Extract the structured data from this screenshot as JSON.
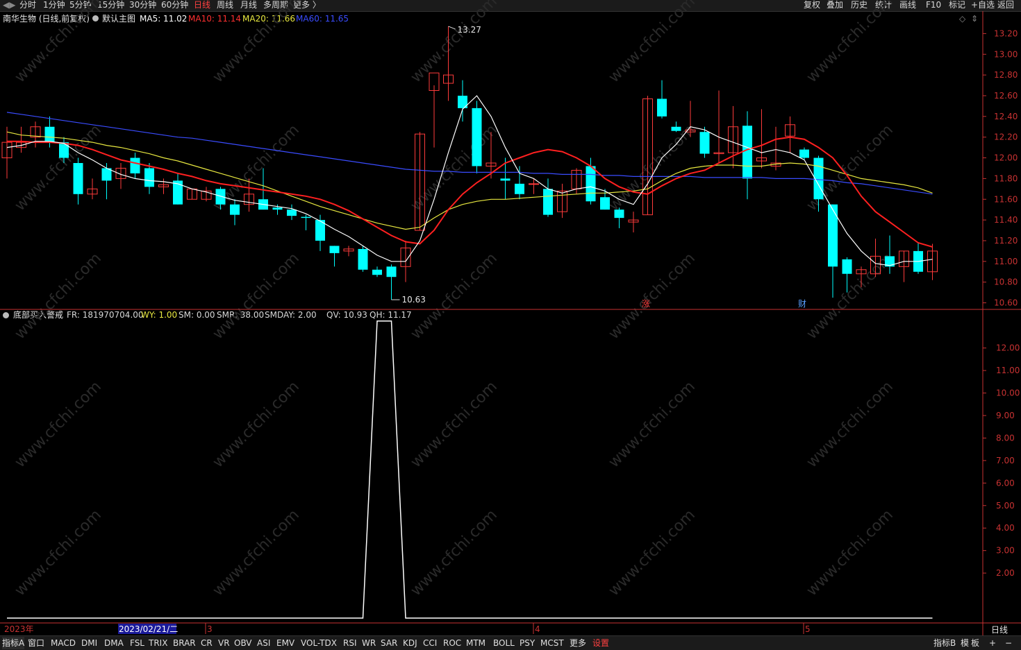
{
  "topbar": {
    "left": [
      "分时",
      "1分钟",
      "5分钟",
      "15分钟",
      "30分钟",
      "60分钟",
      "日线",
      "周线",
      "月线",
      "多周期",
      "更多 〉"
    ],
    "right": [
      "复权",
      "叠加",
      "历史",
      "统计",
      "画线",
      "F10",
      "标记",
      "+自选",
      "返回"
    ]
  },
  "main": {
    "stock_title": "南华生物 (日线,前复权)",
    "template": "默认主图",
    "ma_labels": [
      {
        "text": "MA5: 11.02",
        "color": "#ffffff"
      },
      {
        "text": "MA10: 11.14",
        "color": "#ff3030"
      },
      {
        "text": "MA20: 11.66",
        "color": "#e8e840"
      },
      {
        "text": "MA60: 11.65",
        "color": "#3a4cff"
      }
    ],
    "high_label": "13.27",
    "low_label": "10.63",
    "marker_zhang": "涨",
    "marker_cai": "财",
    "y_ticks": [
      "13.20",
      "13.00",
      "12.80",
      "12.60",
      "12.40",
      "12.20",
      "12.00",
      "11.80",
      "11.60",
      "11.40",
      "11.20",
      "11.00",
      "10.80",
      "10.60"
    ]
  },
  "indicator": {
    "name": "底部买入警戒",
    "fields": [
      {
        "text": "FR: 181970704.00",
        "color": "#d8d8d8"
      },
      {
        "text": "WY: 1.00",
        "color": "#e8e840"
      },
      {
        "text": "SM: 0.00",
        "color": "#d8d8d8"
      },
      {
        "text": "SMR: 38.00",
        "color": "#d8d8d8"
      },
      {
        "text": "SMDAY: 2.00",
        "color": "#d8d8d8"
      },
      {
        "text": "QV: 10.93",
        "color": "#d8d8d8"
      },
      {
        "text": "QH: 11.17",
        "color": "#d8d8d8"
      }
    ],
    "y_ticks": [
      "12.00",
      "11.00",
      "10.00",
      "9.00",
      "8.00",
      "7.00",
      "6.00",
      "5.00",
      "4.00",
      "3.00",
      "2.00"
    ]
  },
  "time_axis": {
    "year": "2023年",
    "date_box": "2023/02/21/二",
    "months": [
      "3",
      "4",
      "5"
    ],
    "period_label": "日线"
  },
  "bottombar": {
    "items": [
      "指标A",
      "窗口",
      "MACD",
      "DMI",
      "DMA",
      "FSL",
      "TRIX",
      "BRAR",
      "CR",
      "VR",
      "OBV",
      "ASI",
      "EMV",
      "VOL-TDX",
      "RSI",
      "WR",
      "SAR",
      "KDJ",
      "CCI",
      "ROC",
      "MTM",
      "BOLL",
      "PSY",
      "MCST",
      "更多",
      "设置"
    ],
    "right": [
      "指标B",
      "模",
      "板",
      "+",
      "−"
    ]
  },
  "watermark": "www.cfchi.com",
  "colors": {
    "up": "#ff3b3b",
    "down": "#00ffff",
    "ma5": "#ffffff",
    "ma10": "#ff2020",
    "ma20": "#e8e840",
    "ma60": "#3a4cff",
    "axis": "#c83232"
  },
  "chart_data": {
    "type": "candlestick",
    "title": "南华生物 (日线,前复权)",
    "ylim": [
      10.55,
      13.35
    ],
    "candles": [
      {
        "o": 12.0,
        "h": 12.3,
        "l": 11.8,
        "c": 12.15
      },
      {
        "o": 12.1,
        "h": 12.3,
        "l": 12.05,
        "c": 12.15
      },
      {
        "o": 12.2,
        "h": 12.35,
        "l": 12.1,
        "c": 12.3
      },
      {
        "o": 12.3,
        "h": 12.4,
        "l": 12.1,
        "c": 12.15
      },
      {
        "o": 12.15,
        "h": 12.2,
        "l": 11.95,
        "c": 12.0
      },
      {
        "o": 11.95,
        "h": 12.0,
        "l": 11.55,
        "c": 11.65
      },
      {
        "o": 11.65,
        "h": 11.8,
        "l": 11.6,
        "c": 11.7
      },
      {
        "o": 11.9,
        "h": 11.95,
        "l": 11.6,
        "c": 11.78
      },
      {
        "o": 11.8,
        "h": 11.95,
        "l": 11.7,
        "c": 11.9
      },
      {
        "o": 12.0,
        "h": 12.05,
        "l": 11.8,
        "c": 11.85
      },
      {
        "o": 11.9,
        "h": 11.95,
        "l": 11.65,
        "c": 11.72
      },
      {
        "o": 11.72,
        "h": 11.8,
        "l": 11.65,
        "c": 11.74
      },
      {
        "o": 11.78,
        "h": 11.85,
        "l": 11.55,
        "c": 11.55
      },
      {
        "o": 11.6,
        "h": 11.7,
        "l": 11.6,
        "c": 11.7
      },
      {
        "o": 11.6,
        "h": 11.72,
        "l": 11.58,
        "c": 11.68
      },
      {
        "o": 11.7,
        "h": 11.72,
        "l": 11.5,
        "c": 11.55
      },
      {
        "o": 11.55,
        "h": 11.6,
        "l": 11.35,
        "c": 11.45
      },
      {
        "o": 11.55,
        "h": 11.8,
        "l": 11.48,
        "c": 11.65
      },
      {
        "o": 11.6,
        "h": 11.9,
        "l": 11.5,
        "c": 11.5
      },
      {
        "o": 11.52,
        "h": 11.55,
        "l": 11.45,
        "c": 11.5
      },
      {
        "o": 11.5,
        "h": 11.55,
        "l": 11.4,
        "c": 11.44
      },
      {
        "o": 11.43,
        "h": 11.45,
        "l": 11.3,
        "c": 11.42
      },
      {
        "o": 11.4,
        "h": 11.45,
        "l": 11.1,
        "c": 11.2
      },
      {
        "o": 11.15,
        "h": 11.15,
        "l": 10.95,
        "c": 11.08
      },
      {
        "o": 11.1,
        "h": 11.15,
        "l": 11.05,
        "c": 11.12
      },
      {
        "o": 11.12,
        "h": 11.15,
        "l": 10.9,
        "c": 10.92
      },
      {
        "o": 10.92,
        "h": 10.95,
        "l": 10.85,
        "c": 10.87
      },
      {
        "o": 10.95,
        "h": 10.97,
        "l": 10.63,
        "c": 10.85
      },
      {
        "o": 10.95,
        "h": 11.2,
        "l": 10.8,
        "c": 11.13
      },
      {
        "o": 11.3,
        "h": 12.25,
        "l": 11.3,
        "c": 12.23
      },
      {
        "o": 12.65,
        "h": 12.7,
        "l": 12.1,
        "c": 12.82
      },
      {
        "o": 12.72,
        "h": 13.27,
        "l": 12.55,
        "c": 12.8
      },
      {
        "o": 12.6,
        "h": 12.75,
        "l": 12.35,
        "c": 12.48
      },
      {
        "o": 12.48,
        "h": 12.55,
        "l": 11.85,
        "c": 11.92
      },
      {
        "o": 11.92,
        "h": 12.25,
        "l": 11.8,
        "c": 11.95
      },
      {
        "o": 11.8,
        "h": 12.0,
        "l": 11.6,
        "c": 11.78
      },
      {
        "o": 11.75,
        "h": 11.92,
        "l": 11.6,
        "c": 11.65
      },
      {
        "o": 11.75,
        "h": 11.8,
        "l": 11.65,
        "c": 11.75
      },
      {
        "o": 11.7,
        "h": 11.8,
        "l": 11.43,
        "c": 11.45
      },
      {
        "o": 11.48,
        "h": 11.75,
        "l": 11.42,
        "c": 11.68
      },
      {
        "o": 11.7,
        "h": 11.9,
        "l": 11.65,
        "c": 11.88
      },
      {
        "o": 11.92,
        "h": 12.0,
        "l": 11.55,
        "c": 11.58
      },
      {
        "o": 11.62,
        "h": 11.7,
        "l": 11.5,
        "c": 11.5
      },
      {
        "o": 11.5,
        "h": 11.52,
        "l": 11.32,
        "c": 11.42
      },
      {
        "o": 11.38,
        "h": 11.48,
        "l": 11.28,
        "c": 11.4
      },
      {
        "o": 11.45,
        "h": 12.6,
        "l": 11.45,
        "c": 12.57
      },
      {
        "o": 12.57,
        "h": 12.75,
        "l": 12.38,
        "c": 12.4
      },
      {
        "o": 12.3,
        "h": 12.35,
        "l": 12.25,
        "c": 12.26
      },
      {
        "o": 12.25,
        "h": 12.55,
        "l": 12.2,
        "c": 12.27
      },
      {
        "o": 12.25,
        "h": 12.3,
        "l": 12.0,
        "c": 12.04
      },
      {
        "o": 12.04,
        "h": 12.65,
        "l": 11.95,
        "c": 12.05
      },
      {
        "o": 12.05,
        "h": 12.5,
        "l": 11.9,
        "c": 12.3
      },
      {
        "o": 12.31,
        "h": 12.45,
        "l": 11.6,
        "c": 11.8
      },
      {
        "o": 11.97,
        "h": 12.47,
        "l": 11.9,
        "c": 12.0
      },
      {
        "o": 11.92,
        "h": 12.3,
        "l": 11.88,
        "c": 11.95
      },
      {
        "o": 12.21,
        "h": 12.4,
        "l": 12.05,
        "c": 12.32
      },
      {
        "o": 12.08,
        "h": 12.1,
        "l": 11.98,
        "c": 12.0
      },
      {
        "o": 12.0,
        "h": 12.02,
        "l": 11.48,
        "c": 11.6
      },
      {
        "o": 11.55,
        "h": 11.55,
        "l": 10.65,
        "c": 10.95
      },
      {
        "o": 11.02,
        "h": 11.04,
        "l": 10.7,
        "c": 10.88
      },
      {
        "o": 10.88,
        "h": 10.95,
        "l": 10.75,
        "c": 10.92
      },
      {
        "o": 10.88,
        "h": 11.22,
        "l": 10.85,
        "c": 11.05
      },
      {
        "o": 11.05,
        "h": 11.25,
        "l": 10.88,
        "c": 10.95
      },
      {
        "o": 10.95,
        "h": 11.1,
        "l": 10.8,
        "c": 11.1
      },
      {
        "o": 11.1,
        "h": 11.18,
        "l": 10.88,
        "c": 10.9
      },
      {
        "o": 10.9,
        "h": 11.17,
        "l": 10.82,
        "c": 11.1
      }
    ],
    "ma5": [
      12.1,
      12.12,
      12.16,
      12.16,
      12.14,
      12.05,
      11.98,
      11.9,
      11.84,
      11.8,
      11.78,
      11.77,
      11.75,
      11.7,
      11.67,
      11.63,
      11.59,
      11.57,
      11.55,
      11.53,
      11.51,
      11.46,
      11.39,
      11.31,
      11.24,
      11.15,
      11.06,
      11.0,
      11.0,
      11.2,
      11.6,
      12.05,
      12.47,
      12.6,
      12.4,
      12.1,
      11.85,
      11.8,
      11.7,
      11.66,
      11.7,
      11.72,
      11.68,
      11.6,
      11.55,
      11.75,
      12.0,
      12.13,
      12.3,
      12.27,
      12.2,
      12.15,
      12.1,
      12.05,
      12.08,
      12.05,
      11.98,
      11.74,
      11.5,
      11.27,
      11.1,
      10.98,
      10.96,
      11.0,
      11.0,
      11.02
    ],
    "ma10": [
      12.16,
      12.16,
      12.15,
      12.15,
      12.14,
      12.12,
      12.08,
      12.03,
      11.98,
      11.95,
      11.92,
      11.89,
      11.85,
      11.82,
      11.78,
      11.75,
      11.73,
      11.71,
      11.69,
      11.67,
      11.65,
      11.63,
      11.6,
      11.55,
      11.49,
      11.41,
      11.33,
      11.25,
      11.19,
      11.17,
      11.3,
      11.5,
      11.65,
      11.76,
      11.85,
      11.95,
      12.0,
      12.05,
      12.08,
      12.06,
      12.0,
      11.92,
      11.8,
      11.72,
      11.67,
      11.65,
      11.73,
      11.8,
      11.85,
      11.88,
      11.95,
      12.02,
      12.08,
      12.12,
      12.18,
      12.2,
      12.18,
      12.1,
      12.0,
      11.83,
      11.63,
      11.48,
      11.38,
      11.28,
      11.18,
      11.14
    ],
    "ma20": [
      12.25,
      12.22,
      12.21,
      12.2,
      12.19,
      12.17,
      12.15,
      12.12,
      12.1,
      12.07,
      12.04,
      12.0,
      11.97,
      11.93,
      11.89,
      11.85,
      11.81,
      11.77,
      11.73,
      11.68,
      11.63,
      11.58,
      11.53,
      11.49,
      11.45,
      11.41,
      11.37,
      11.34,
      11.31,
      11.33,
      11.42,
      11.5,
      11.55,
      11.58,
      11.6,
      11.6,
      11.61,
      11.62,
      11.63,
      11.64,
      11.65,
      11.66,
      11.66,
      11.67,
      11.68,
      11.7,
      11.78,
      11.85,
      11.9,
      11.92,
      11.93,
      11.93,
      11.92,
      11.92,
      11.94,
      11.95,
      11.94,
      11.92,
      11.88,
      11.84,
      11.8,
      11.78,
      11.76,
      11.74,
      11.71,
      11.66
    ],
    "ma60": [
      12.44,
      12.42,
      12.4,
      12.38,
      12.36,
      12.34,
      12.32,
      12.3,
      12.28,
      12.26,
      12.24,
      12.22,
      12.2,
      12.19,
      12.17,
      12.15,
      12.13,
      12.11,
      12.09,
      12.07,
      12.05,
      12.03,
      12.01,
      11.99,
      11.97,
      11.95,
      11.93,
      11.91,
      11.89,
      11.88,
      11.87,
      11.87,
      11.86,
      11.86,
      11.86,
      11.86,
      11.86,
      11.85,
      11.85,
      11.84,
      11.84,
      11.84,
      11.83,
      11.83,
      11.82,
      11.82,
      11.82,
      11.82,
      11.82,
      11.81,
      11.81,
      11.81,
      11.81,
      11.81,
      11.8,
      11.8,
      11.8,
      11.79,
      11.78,
      11.76,
      11.75,
      11.73,
      11.71,
      11.69,
      11.67,
      11.65
    ],
    "indicator_type": "line",
    "indicator_ylim": [
      0,
      13.5
    ],
    "indicator_values": [
      0,
      0,
      0,
      0,
      0,
      0,
      0,
      0,
      0,
      0,
      0,
      0,
      0,
      0,
      0,
      0,
      0,
      0,
      0,
      0,
      0,
      0,
      0,
      0,
      0,
      0,
      13.2,
      13.2,
      0,
      0,
      0,
      0,
      0,
      0,
      0,
      0,
      0,
      0,
      0,
      0,
      0,
      0,
      0,
      0,
      0,
      0,
      0,
      0,
      0,
      0,
      0,
      0,
      0,
      0,
      0,
      0,
      0,
      0,
      0,
      0,
      0,
      0,
      0,
      0,
      0,
      0
    ]
  }
}
